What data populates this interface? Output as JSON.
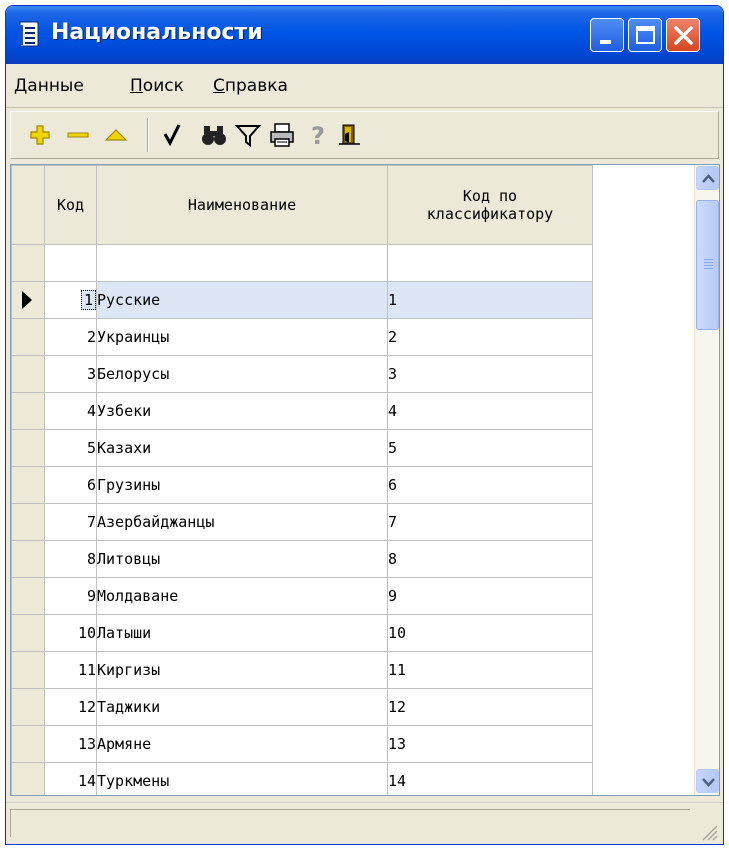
{
  "window": {
    "title": "Национальности"
  },
  "menu": {
    "items": [
      {
        "label_ul": "Д",
        "label_rest": "анные"
      },
      {
        "label_ul": "П",
        "label_rest": "оиск"
      },
      {
        "label_ul": "С",
        "label_rest": "правка"
      }
    ]
  },
  "toolbar": {
    "buttons": [
      "add-icon",
      "delete-icon",
      "edit-icon",
      "apply-icon",
      "find-icon",
      "filter-icon",
      "print-icon",
      "help-icon",
      "exit-icon"
    ]
  },
  "grid": {
    "columns": [
      "Код",
      "Наименование",
      "Код по\nклассификатору"
    ],
    "selected_index": 0,
    "rows": [
      {
        "code": "1",
        "name": "Русские",
        "cls": "1"
      },
      {
        "code": "2",
        "name": "Украинцы",
        "cls": "2"
      },
      {
        "code": "3",
        "name": "Белорусы",
        "cls": "3"
      },
      {
        "code": "4",
        "name": "Узбеки",
        "cls": "4"
      },
      {
        "code": "5",
        "name": "Казахи",
        "cls": "5"
      },
      {
        "code": "6",
        "name": "Грузины",
        "cls": "6"
      },
      {
        "code": "7",
        "name": "Азербайджанцы",
        "cls": "7"
      },
      {
        "code": "8",
        "name": "Литовцы",
        "cls": "8"
      },
      {
        "code": "9",
        "name": "Молдаване",
        "cls": "9"
      },
      {
        "code": "10",
        "name": "Латыши",
        "cls": "10"
      },
      {
        "code": "11",
        "name": "Киргизы",
        "cls": "11"
      },
      {
        "code": "12",
        "name": "Таджики",
        "cls": "12"
      },
      {
        "code": "13",
        "name": "Армяне",
        "cls": "13"
      },
      {
        "code": "14",
        "name": "Туркмены",
        "cls": "14"
      }
    ]
  },
  "colors": {
    "titlebar": "#0055e5",
    "selection": "#dde6f5"
  }
}
